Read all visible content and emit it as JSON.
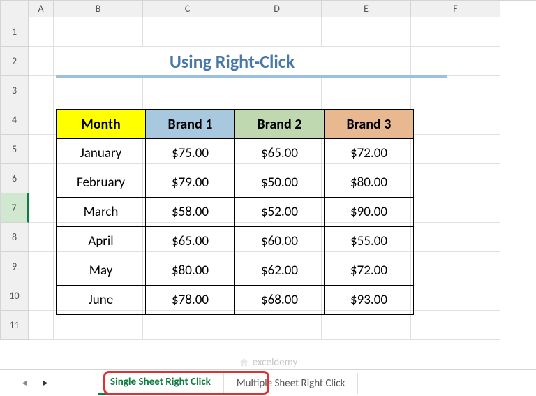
{
  "columns": [
    "A",
    "B",
    "C",
    "D",
    "E",
    "F"
  ],
  "rows": [
    "1",
    "2",
    "3",
    "4",
    "5",
    "6",
    "7",
    "8",
    "9",
    "10",
    "11"
  ],
  "selectedRow": "7",
  "title": "Using Right-Click",
  "table": {
    "headers": [
      "Month",
      "Brand 1",
      "Brand 2",
      "Brand 3"
    ],
    "rows": [
      [
        "January",
        "$75.00",
        "$65.00",
        "$72.00"
      ],
      [
        "February",
        "$79.00",
        "$50.00",
        "$80.00"
      ],
      [
        "March",
        "$58.00",
        "$52.00",
        "$90.00"
      ],
      [
        "April",
        "$65.00",
        "$60.00",
        "$55.00"
      ],
      [
        "May",
        "$80.00",
        "$62.00",
        "$72.00"
      ],
      [
        "June",
        "$78.00",
        "$68.00",
        "$93.00"
      ]
    ]
  },
  "tabs": {
    "active": "Single Sheet Right Click",
    "inactive": "Multiple Sheet Right Click"
  },
  "watermark": "exceldemy"
}
